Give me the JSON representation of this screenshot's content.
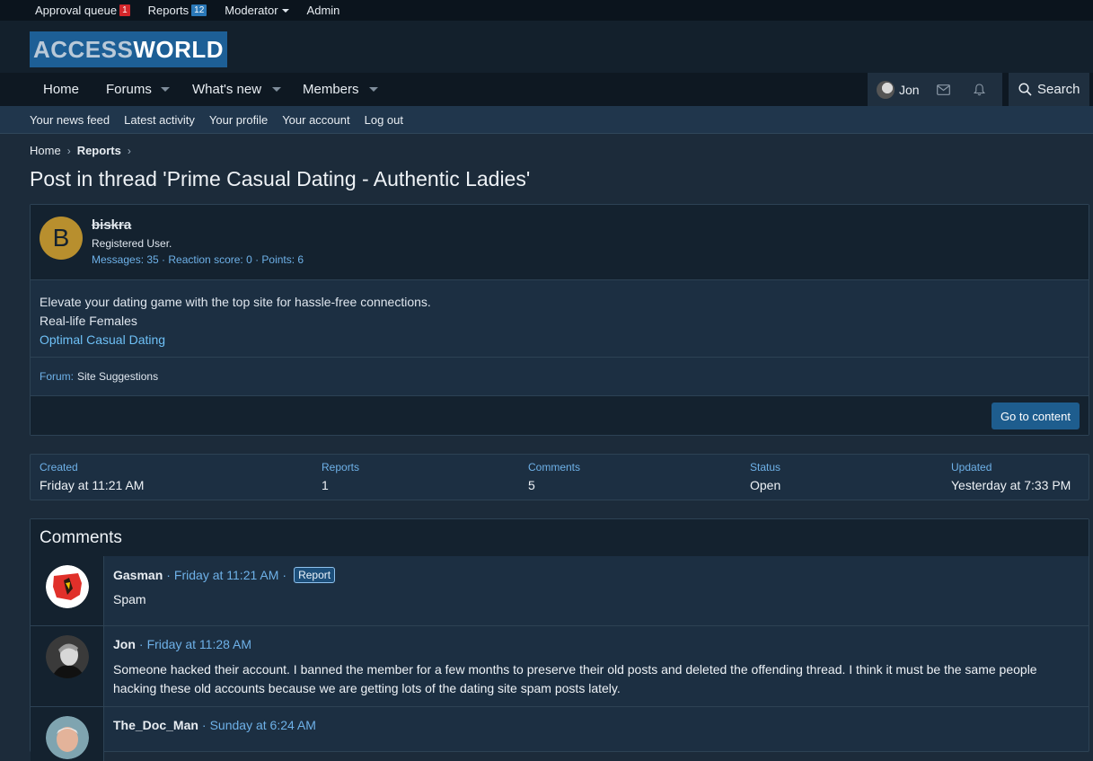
{
  "staffbar": {
    "approval_label": "Approval queue",
    "approval_count": "1",
    "reports_label": "Reports",
    "reports_count": "12",
    "moderator_label": "Moderator",
    "admin_label": "Admin"
  },
  "logo": {
    "part1": "ACCESS",
    "part2": "WORLD"
  },
  "nav": {
    "home": "Home",
    "forums": "Forums",
    "whats_new": "What's new",
    "members": "Members",
    "user": "Jon",
    "search": "Search"
  },
  "subnav": {
    "news_feed": "Your news feed",
    "latest_activity": "Latest activity",
    "profile": "Your profile",
    "account": "Your account",
    "logout": "Log out"
  },
  "breadcrumb": {
    "home": "Home",
    "reports": "Reports"
  },
  "page_title": "Post in thread 'Prime Casual Dating - Authentic Ladies'",
  "report": {
    "avatar_letter": "B",
    "username": "biskra",
    "user_title": "Registered User.",
    "user_stats": "Messages: 35 · Reaction score: 0 · Points: 6",
    "body_line1": "Elevate your dating game with the top site for hassle-free connections.",
    "body_line2": "Real-life Females",
    "body_link": "Optimal Casual Dating",
    "forum_label": "Forum:",
    "forum_name": "Site Suggestions",
    "go_button": "Go to content"
  },
  "stats": {
    "created_label": "Created",
    "created_value": "Friday at 11:21 AM",
    "reports_label": "Reports",
    "reports_value": "1",
    "comments_label": "Comments",
    "comments_value": "5",
    "status_label": "Status",
    "status_value": "Open",
    "updated_label": "Updated",
    "updated_value": "Yesterday at 7:33 PM"
  },
  "comments": {
    "heading": "Comments",
    "items": [
      {
        "author": "Gasman",
        "time": "Friday at 11:21 AM",
        "badge": "Report",
        "text": "Spam"
      },
      {
        "author": "Jon",
        "time": "Friday at 11:28 AM",
        "text": "Someone hacked their account. I banned the member for a few months to preserve their old posts and deleted the offending thread. I think it must be the same people hacking these old accounts because we are getting lots of the dating site spam posts lately."
      },
      {
        "author": "The_Doc_Man",
        "time": "Sunday at 6:24 AM"
      }
    ]
  },
  "colors": {
    "accent_blue": "#6eb1e8",
    "badge_red": "#d3262a",
    "button_blue": "#1e5d8e",
    "avatar_gold": "#b88f2e"
  }
}
